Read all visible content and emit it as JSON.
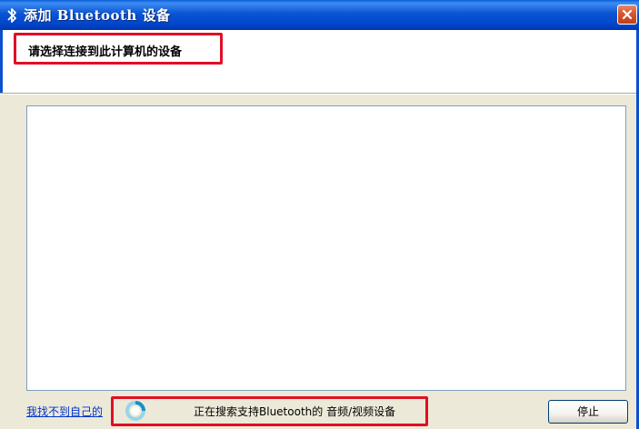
{
  "window": {
    "title": "添加 Bluetooth 设备",
    "icon": "bluetooth-icon",
    "close_icon": "close-icon"
  },
  "header": {
    "title": "请选择连接到此计算机的设备"
  },
  "device_list": {
    "items": []
  },
  "footer": {
    "help_link": "我找不到自己的",
    "status_text": "正在搜索支持Bluetooth的 音频/视频设备",
    "spinner_icon": "loading-spinner-icon",
    "stop_button": "停止"
  },
  "colors": {
    "titlebar": "#0055d4",
    "highlight": "#e00f25",
    "link": "#0033cc",
    "dialog_bg": "#ece9d8"
  }
}
